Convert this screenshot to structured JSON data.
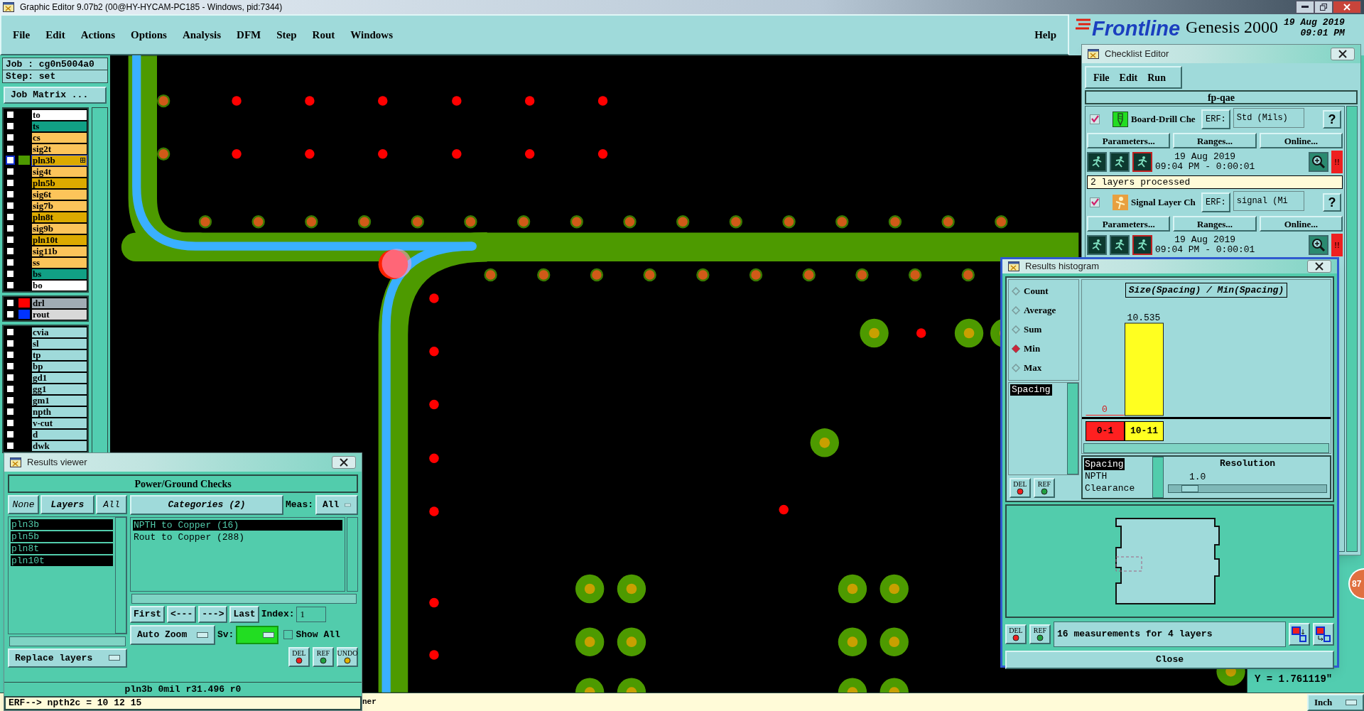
{
  "window": {
    "title": "Graphic Editor 9.07b2 (00@HY-HYCAM-PC185 - Windows, pid:7344)"
  },
  "menu": [
    {
      "label": "File"
    },
    {
      "label": "Edit"
    },
    {
      "label": "Actions"
    },
    {
      "label": "Options"
    },
    {
      "label": "Analysis"
    },
    {
      "label": "DFM"
    },
    {
      "label": "Step"
    },
    {
      "label": "Rout"
    },
    {
      "label": "Windows"
    }
  ],
  "help": "Help",
  "brand": {
    "logo": "Frontline",
    "product": "Genesis 2000",
    "date": "19 Aug 2019",
    "time": "09:01 PM"
  },
  "job": {
    "job": "Job : cg0n5004a0",
    "step": "Step: set",
    "matrix_button": "Job Matrix ..."
  },
  "layer_groups": [
    [
      {
        "name": "to",
        "color": "#ffffff",
        "selected": false,
        "checked": false
      },
      {
        "name": "ts",
        "color": "#11a085",
        "selected": false,
        "checked": false
      },
      {
        "name": "cs",
        "color": "#fcc45a",
        "selected": false,
        "checked": false
      },
      {
        "name": "sig2t",
        "color": "#fcc45a",
        "selected": false,
        "checked": false
      },
      {
        "name": "pln3b",
        "color": "#dcaa00",
        "selected": true,
        "checked": false,
        "swatch": {
          "color": "#4d9a00"
        }
      },
      {
        "name": "sig4t",
        "color": "#fcc45a",
        "selected": false,
        "checked": false
      },
      {
        "name": "pln5b",
        "color": "#dcaa00",
        "selected": false,
        "checked": false
      },
      {
        "name": "sig6t",
        "color": "#fcc45a",
        "selected": false,
        "checked": false
      },
      {
        "name": "sig7b",
        "color": "#fcc45a",
        "selected": false,
        "checked": false
      },
      {
        "name": "pln8t",
        "color": "#dcaa00",
        "selected": false,
        "checked": false
      },
      {
        "name": "sig9b",
        "color": "#fcc45a",
        "selected": false,
        "checked": false
      },
      {
        "name": "pln10t",
        "color": "#dcaa00",
        "selected": false,
        "checked": false
      },
      {
        "name": "sig11b",
        "color": "#fcc45a",
        "selected": false,
        "checked": false
      },
      {
        "name": "ss",
        "color": "#fcc45a",
        "selected": false,
        "checked": false
      },
      {
        "name": "bs",
        "color": "#11a085",
        "selected": false,
        "checked": false
      },
      {
        "name": "bo",
        "color": "#ffffff",
        "selected": false,
        "checked": false
      }
    ],
    [
      {
        "name": "drl",
        "color": "#a0acb4",
        "selected": false,
        "checked": false,
        "swatch": {
          "color": "#ff0000"
        }
      },
      {
        "name": "rout",
        "color": "#d8d8d8",
        "selected": false,
        "checked": false,
        "swatch": {
          "color": "#0033ff"
        }
      }
    ],
    [
      {
        "name": "cvia",
        "color": "#9fdada",
        "selected": false,
        "checked": false
      },
      {
        "name": "sl",
        "color": "#9fdada",
        "selected": false,
        "checked": false
      },
      {
        "name": "tp",
        "color": "#9fdada",
        "selected": false,
        "checked": false
      },
      {
        "name": "bp",
        "color": "#9fdada",
        "selected": false,
        "checked": false
      },
      {
        "name": "gd1",
        "color": "#9fdada",
        "selected": false,
        "checked": false
      },
      {
        "name": "gg1",
        "color": "#9fdada",
        "selected": false,
        "checked": false
      },
      {
        "name": "gm1",
        "color": "#9fdada",
        "selected": false,
        "checked": false
      },
      {
        "name": "npth",
        "color": "#9fdada",
        "selected": false,
        "checked": false
      },
      {
        "name": "v-cut",
        "color": "#9fdada",
        "selected": false,
        "checked": false
      },
      {
        "name": "d",
        "color": "#9fdada",
        "selected": false,
        "checked": false
      },
      {
        "name": "dwk",
        "color": "#9fdada",
        "selected": false,
        "checked": false
      }
    ]
  ],
  "coordinate": "Y = 1.761119\"",
  "status_bar": {
    "text": "ner",
    "units": "Inch"
  },
  "badge": "87",
  "results_viewer": {
    "title": "Results viewer",
    "heading": "Power/Ground Checks",
    "layer_buttons": [
      "None",
      "Layers",
      "All"
    ],
    "layers": [
      {
        "label": "pln3b",
        "selected": true
      },
      {
        "label": "pln5b",
        "selected": true
      },
      {
        "label": "pln8t",
        "selected": true
      },
      {
        "label": "pln10t",
        "selected": true
      }
    ],
    "categories_button": "Categories (2)",
    "meas_label": "Meas:",
    "meas_value": "All",
    "categories": [
      {
        "label": "NPTH to Copper (16)",
        "selected": true
      },
      {
        "label": "Rout to Copper (288)",
        "selected": false
      }
    ],
    "nav_buttons": [
      "First",
      "<---",
      "--->",
      "Last"
    ],
    "index_label": "Index:",
    "index_value": "1",
    "zoom_mode": "Auto Zoom",
    "sv_label": "Sv:",
    "show_all": {
      "label": "Show All",
      "checked": false
    },
    "replace_mode": "Replace layers",
    "action_buttons": [
      "DEL",
      "REF",
      "UNDO"
    ],
    "info": "pln3b 0mil r31.496 r0",
    "erf": "ERF--> npth2c = 10 12 15"
  },
  "checklist_editor": {
    "title": "Checklist Editor",
    "menu": [
      "File",
      "Edit",
      "Run"
    ],
    "name": "fp-qae",
    "checks": [
      {
        "kind": "drill",
        "name": "Board-Drill Che",
        "checked": true,
        "erf_label": "ERF:",
        "erf_value": "Std (Mils)",
        "help": "?",
        "buttons": [
          "Parameters...",
          "Ranges...",
          "Online..."
        ],
        "date": "19 Aug 2019",
        "time": "09:04 PM - 0:00:01",
        "alert": "!!",
        "status": "2 layers processed"
      },
      {
        "kind": "signal",
        "name": "Signal Layer Ch",
        "checked": true,
        "erf_label": "ERF:",
        "erf_value": "signal (Mi",
        "help": "?",
        "buttons": [
          "Parameters...",
          "Ranges...",
          "Online..."
        ],
        "date": "19 Aug 2019",
        "time": "09:04 PM - 0:00:01",
        "alert": "!!"
      }
    ]
  },
  "results_histogram": {
    "title": "Results histogram",
    "modes": [
      {
        "label": "Count",
        "selected": false
      },
      {
        "label": "Average",
        "selected": false
      },
      {
        "label": "Sum",
        "selected": false
      },
      {
        "label": "Min",
        "selected": true
      },
      {
        "label": "Max",
        "selected": false
      }
    ],
    "measures": [
      {
        "label": "Spacing",
        "selected": true
      }
    ],
    "chart_data": {
      "type": "bar",
      "title": "Size(Spacing) / Min(Spacing)",
      "categories": [
        "0-1",
        "10-11"
      ],
      "values": [
        0,
        10.535
      ],
      "data_labels": true
    },
    "metrics": [
      {
        "label": "Spacing",
        "selected": true
      },
      {
        "label": "NPTH",
        "selected": false
      },
      {
        "label": "Clearance",
        "selected": false
      }
    ],
    "resolution_label": "Resolution",
    "resolution_value": "1.0",
    "resolution": {
      "level": 0.08
    },
    "small_buttons": [
      "DEL",
      "REF"
    ],
    "bottom_buttons": [
      "DEL",
      "REF"
    ],
    "summary": "16 measurements for 4 layers",
    "close": "Close"
  }
}
